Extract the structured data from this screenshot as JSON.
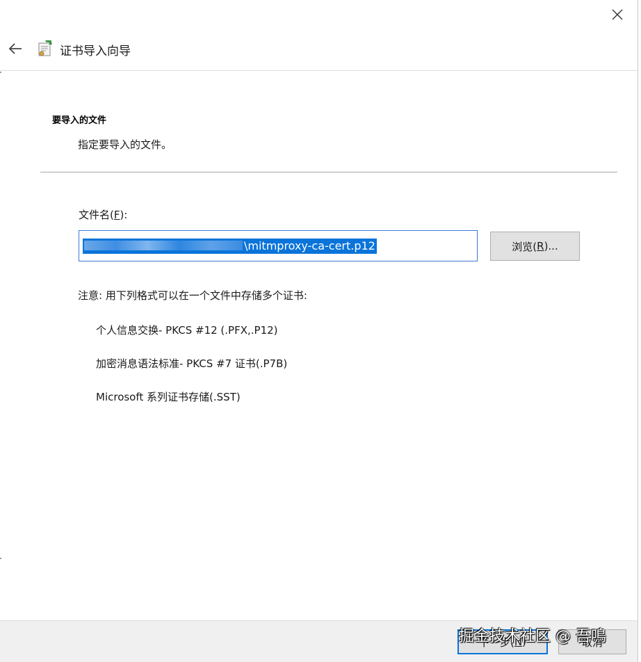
{
  "window": {
    "title": "证书导入向导"
  },
  "page": {
    "section_title": "要导入的文件",
    "section_desc": "指定要导入的文件。"
  },
  "file": {
    "label_prefix": "文件名(",
    "label_accel": "F",
    "label_suffix": "):",
    "value_visible": "\\mitmproxy-ca-cert.p12",
    "browse_prefix": "浏览(",
    "browse_accel": "R",
    "browse_suffix": ")..."
  },
  "note": "注意: 用下列格式可以在一个文件中存储多个证书:",
  "formats": [
    "个人信息交换- PKCS #12 (.PFX,.P12)",
    "加密消息语法标准- PKCS #7 证书(.P7B)",
    "Microsoft 系列证书存储(.SST)"
  ],
  "footer": {
    "next_prefix": "下一步(",
    "next_accel": "N",
    "next_suffix": ")",
    "cancel": "取消"
  },
  "watermark": "掘金技术社区 @ 吾鳴",
  "icons": {
    "close": "close-icon",
    "back": "back-arrow-icon",
    "wizard": "certificate-wizard-icon"
  },
  "colors": {
    "accent": "#0a74da",
    "input_border": "#3b78d8",
    "button_bg": "#e1e1e1",
    "footer_bg": "#f0f0f0"
  }
}
